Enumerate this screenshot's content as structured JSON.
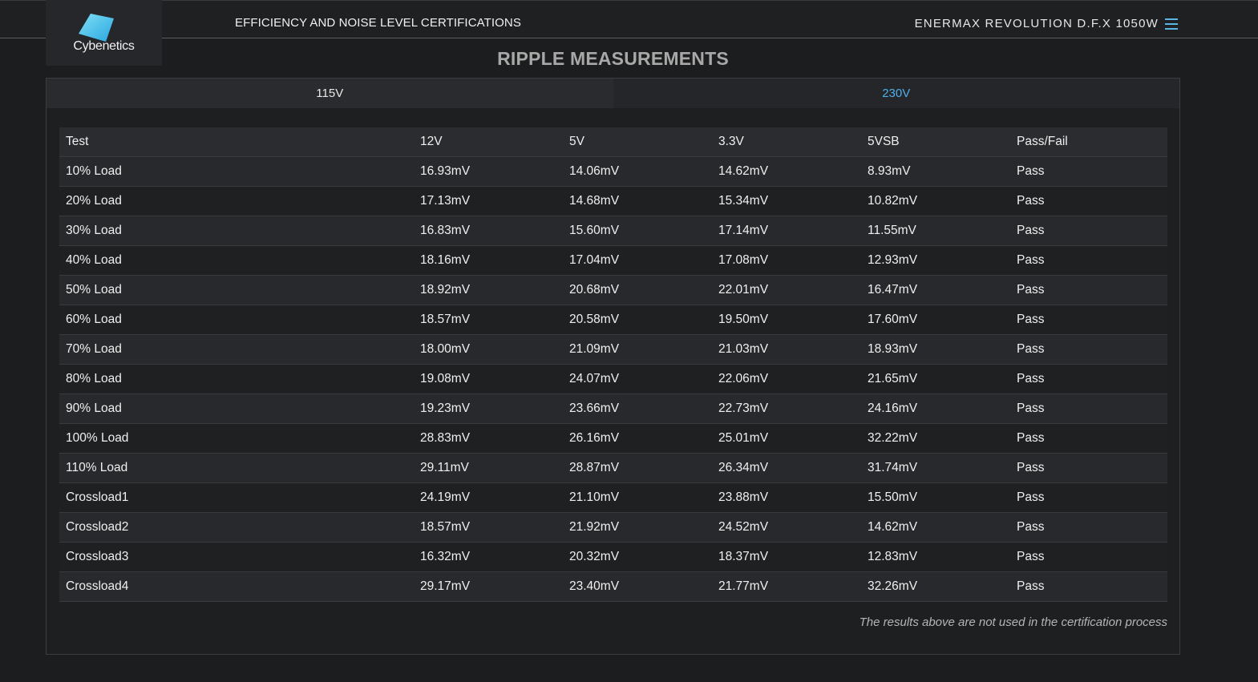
{
  "header": {
    "logo_text": "Cybenetics",
    "nav_title": "EFFICIENCY AND NOISE LEVEL CERTIFICATIONS",
    "product_name": "ENERMAX REVOLUTION D.F.X 1050W",
    "menu_icon": "hamburger-menu-icon"
  },
  "page_title": "RIPPLE MEASUREMENTS",
  "tabs": [
    {
      "label": "115V",
      "active": false
    },
    {
      "label": "230V",
      "active": true
    }
  ],
  "colors": {
    "accent": "#4fb0ea",
    "background": "#1c1d1f"
  },
  "table": {
    "headers": [
      "Test",
      "12V",
      "5V",
      "3.3V",
      "5VSB",
      "Pass/Fail"
    ],
    "rows": [
      [
        "10% Load",
        "16.93mV",
        "14.06mV",
        "14.62mV",
        "8.93mV",
        "Pass"
      ],
      [
        "20% Load",
        "17.13mV",
        "14.68mV",
        "15.34mV",
        "10.82mV",
        "Pass"
      ],
      [
        "30% Load",
        "16.83mV",
        "15.60mV",
        "17.14mV",
        "11.55mV",
        "Pass"
      ],
      [
        "40% Load",
        "18.16mV",
        "17.04mV",
        "17.08mV",
        "12.93mV",
        "Pass"
      ],
      [
        "50% Load",
        "18.92mV",
        "20.68mV",
        "22.01mV",
        "16.47mV",
        "Pass"
      ],
      [
        "60% Load",
        "18.57mV",
        "20.58mV",
        "19.50mV",
        "17.60mV",
        "Pass"
      ],
      [
        "70% Load",
        "18.00mV",
        "21.09mV",
        "21.03mV",
        "18.93mV",
        "Pass"
      ],
      [
        "80% Load",
        "19.08mV",
        "24.07mV",
        "22.06mV",
        "21.65mV",
        "Pass"
      ],
      [
        "90% Load",
        "19.23mV",
        "23.66mV",
        "22.73mV",
        "24.16mV",
        "Pass"
      ],
      [
        "100% Load",
        "28.83mV",
        "26.16mV",
        "25.01mV",
        "32.22mV",
        "Pass"
      ],
      [
        "110% Load",
        "29.11mV",
        "28.87mV",
        "26.34mV",
        "31.74mV",
        "Pass"
      ],
      [
        "Crossload1",
        "24.19mV",
        "21.10mV",
        "23.88mV",
        "15.50mV",
        "Pass"
      ],
      [
        "Crossload2",
        "18.57mV",
        "21.92mV",
        "24.52mV",
        "14.62mV",
        "Pass"
      ],
      [
        "Crossload3",
        "16.32mV",
        "20.32mV",
        "18.37mV",
        "12.83mV",
        "Pass"
      ],
      [
        "Crossload4",
        "29.17mV",
        "23.40mV",
        "21.77mV",
        "32.26mV",
        "Pass"
      ]
    ]
  },
  "note": "The results above are not used in the certification process"
}
